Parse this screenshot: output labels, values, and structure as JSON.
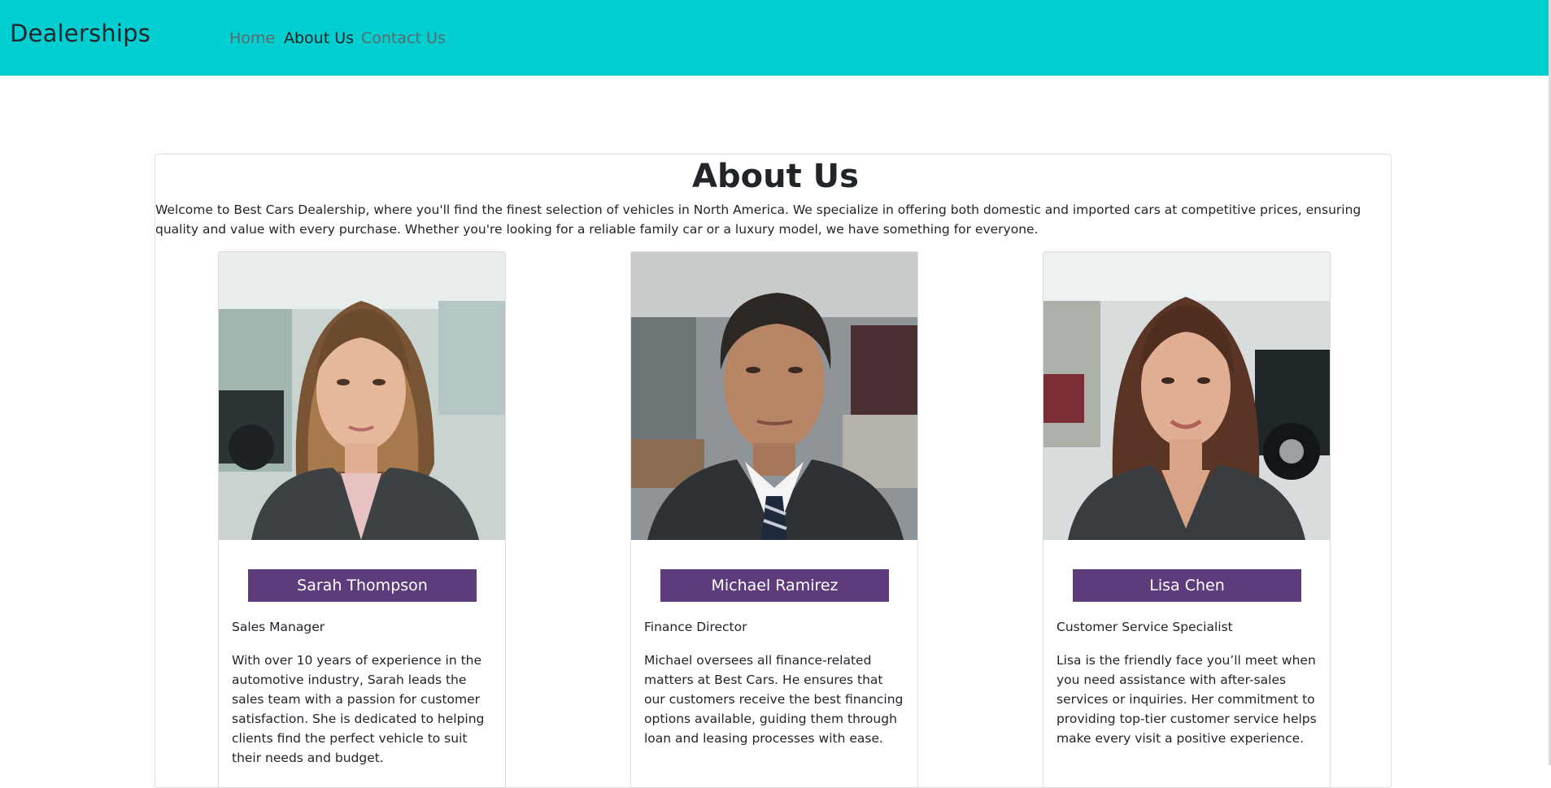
{
  "navbar": {
    "brand": "Dealerships",
    "links": [
      {
        "label": "Home",
        "active": false
      },
      {
        "label": "About Us",
        "active": true
      },
      {
        "label": "Contact Us",
        "active": false
      }
    ],
    "background": "#00ced1"
  },
  "about": {
    "title": "About Us",
    "intro": "Welcome to Best Cars Dealership, where you'll find the finest selection of vehicles in North America. We specialize in offering both domestic and imported cars at competitive prices, ensuring quality and value with every purchase. Whether you're looking for a reliable family car or a luxury model, we have something for everyone."
  },
  "team": [
    {
      "name": "Sarah Thompson",
      "role": "Sales Manager",
      "bio": "With over 10 years of experience in the automotive industry, Sarah leads the sales team with a passion for customer satisfaction. She is dedicated to helping clients find the perfect vehicle to suit their needs and budget.",
      "photo": "portrait-woman-blonde-hair-blazer"
    },
    {
      "name": "Michael Ramirez",
      "role": "Finance Director",
      "bio": "Michael oversees all finance-related matters at Best Cars. He ensures that our customers receive the best financing options available, guiding them through loan and leasing processes with ease.",
      "photo": "portrait-man-suit-striped-tie"
    },
    {
      "name": "Lisa Chen",
      "role": "Customer Service Specialist",
      "bio": "Lisa is the friendly face you’ll meet when you need assistance with after-sales services or inquiries. Her commitment to providing top-tier customer service helps make every visit a positive experience.",
      "photo": "portrait-woman-brown-hair-blazer"
    }
  ],
  "colors": {
    "accent": "#5e3c7b",
    "navbar": "#00ced1"
  }
}
